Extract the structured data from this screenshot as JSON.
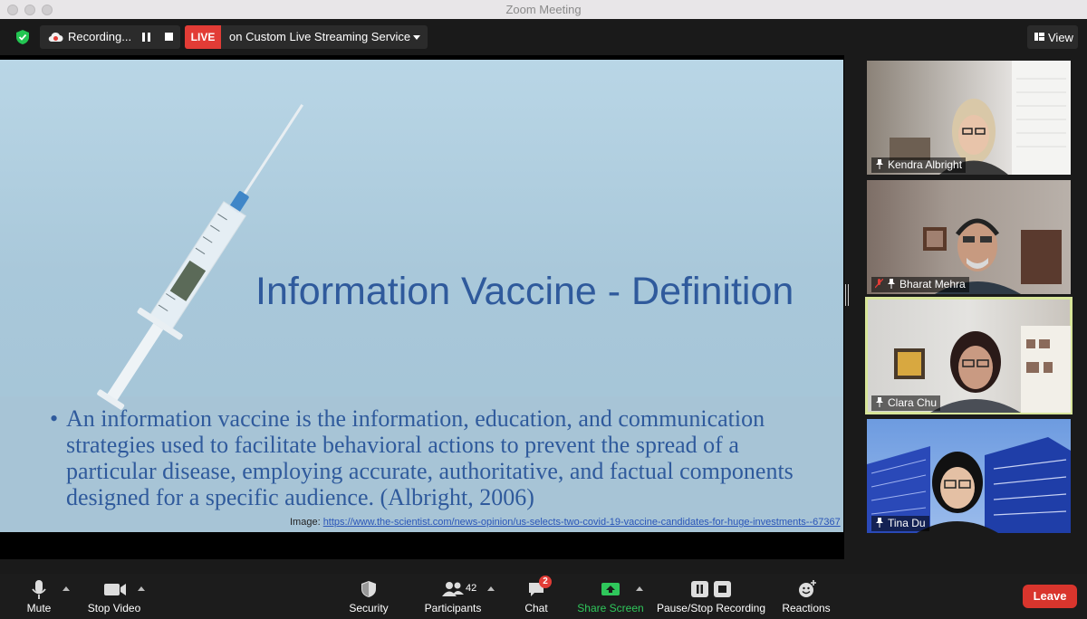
{
  "window": {
    "title": "Zoom Meeting"
  },
  "topbar": {
    "recording_label": "Recording...",
    "live_badge": "LIVE",
    "live_label": "on Custom Live Streaming Service",
    "view_label": "View"
  },
  "slide": {
    "title": "Information Vaccine - Definition",
    "bullet": "•",
    "body": "An information vaccine is the information, education, and communication strategies used to facilitate behavioral actions to prevent the spread of a particular disease, employing accurate, authoritative, and factual components designed for a specific audience. (Albright, 2006)",
    "image_prefix": "Image: ",
    "image_link": "https://www.the-scientist.com/news-opinion/us-selects-two-covid-19-vaccine-candidates-for-huge-investments--67367"
  },
  "participants_gallery": [
    {
      "name": "Kendra Albright"
    },
    {
      "name": "Bharat Mehra"
    },
    {
      "name": "Clara Chu"
    },
    {
      "name": "Tina Du"
    }
  ],
  "toolbar": {
    "mute": "Mute",
    "stop_video": "Stop Video",
    "security": "Security",
    "participants": "Participants",
    "participants_count": "42",
    "chat": "Chat",
    "chat_badge": "2",
    "share_screen": "Share Screen",
    "pause_stop_recording": "Pause/Stop Recording",
    "reactions": "Reactions",
    "leave": "Leave"
  },
  "colors": {
    "live_red": "#e23c36",
    "share_green": "#2fc75b",
    "leave_red": "#d9352d",
    "active_speaker": "#d8e69a",
    "slide_text": "#2f5a9c"
  }
}
